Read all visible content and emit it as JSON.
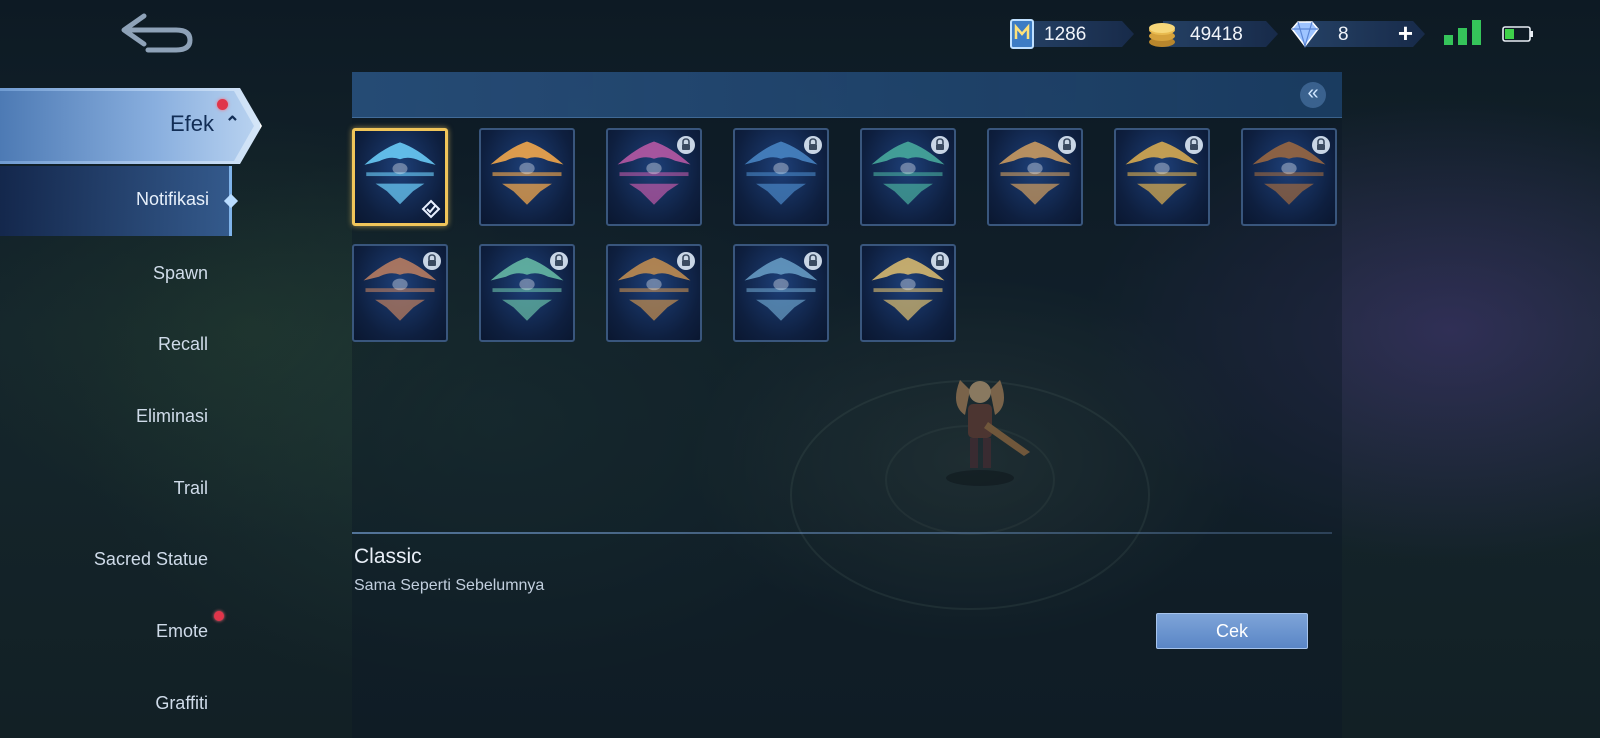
{
  "currency": {
    "ticket": "1286",
    "gold": "49418",
    "diamond": "8",
    "add_label": "+"
  },
  "sidebar": {
    "category": {
      "label": "Efek",
      "expanded_icon": "chevron-up-icon",
      "has_badge": true
    },
    "active_item": "Notifikasi",
    "items": [
      {
        "label": "Spawn"
      },
      {
        "label": "Recall"
      },
      {
        "label": "Eliminasi"
      },
      {
        "label": "Trail"
      },
      {
        "label": "Sacred Statue"
      },
      {
        "label": "Emote",
        "has_badge": true
      },
      {
        "label": "Graffiti"
      }
    ]
  },
  "grid": {
    "cards": [
      {
        "selected": true,
        "locked": false,
        "equipped": true,
        "accent": "#6fd3ff"
      },
      {
        "selected": false,
        "locked": false,
        "equipped": false,
        "accent": "#ffae4a"
      },
      {
        "selected": false,
        "locked": true,
        "equipped": false,
        "accent": "#c05aa8"
      },
      {
        "selected": false,
        "locked": true,
        "equipped": false,
        "accent": "#4a88c8"
      },
      {
        "selected": false,
        "locked": true,
        "equipped": false,
        "accent": "#4ab0a0"
      },
      {
        "selected": false,
        "locked": true,
        "equipped": false,
        "accent": "#d4a060"
      },
      {
        "selected": false,
        "locked": true,
        "equipped": false,
        "accent": "#e0b050"
      },
      {
        "selected": false,
        "locked": true,
        "equipped": false,
        "accent": "#a06a40"
      },
      {
        "selected": false,
        "locked": true,
        "equipped": false,
        "accent": "#c08060"
      },
      {
        "selected": false,
        "locked": true,
        "equipped": false,
        "accent": "#6ac0a8"
      },
      {
        "selected": false,
        "locked": true,
        "equipped": false,
        "accent": "#c89050"
      },
      {
        "selected": false,
        "locked": true,
        "equipped": false,
        "accent": "#6aa0c8"
      },
      {
        "selected": false,
        "locked": true,
        "equipped": false,
        "accent": "#e0c070"
      }
    ]
  },
  "detail": {
    "name": "Classic",
    "description": "Sama Seperti Sebelumnya",
    "button_label": "Cek"
  },
  "colors": {
    "selected_border": "#f0c55a",
    "badge": "#e0354a",
    "button": "#6a93cf"
  }
}
